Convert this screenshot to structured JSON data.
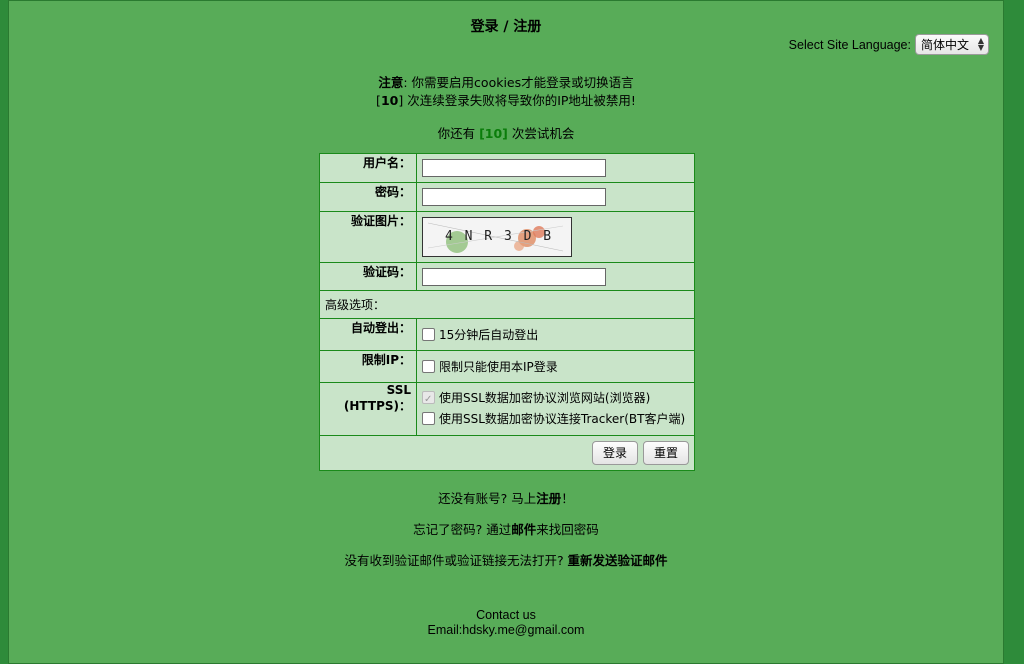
{
  "header": {
    "title": "登录 / 注册"
  },
  "language": {
    "label": "Select Site Language:",
    "selected": "简体中文"
  },
  "notice": {
    "bold_prefix": "注意",
    "line1_rest": ": 你需要启用cookies才能登录或切换语言",
    "count": "10",
    "line2_rest": " 次连续登录失败将导致你的IP地址被禁用!"
  },
  "remaining": {
    "prefix": "你还有 ",
    "count": "[10]",
    "suffix": " 次尝试机会"
  },
  "form": {
    "username_label": "用户名：",
    "password_label": "密码：",
    "captcha_label": "验证图片：",
    "captcha_text": "4 N R 3 D B",
    "code_label": "验证码：",
    "advanced_label": "高级选项：",
    "autologout_label": "自动登出：",
    "autologout_option": "15分钟后自动登出",
    "restrict_ip_label": "限制IP：",
    "restrict_ip_option": "限制只能使用本IP登录",
    "ssl_label": "SSL (HTTPS)：",
    "ssl_browse_option": "使用SSL数据加密协议浏览网站(浏览器)",
    "ssl_tracker_option": "使用SSL数据加密协议连接Tracker(BT客户端)",
    "login_button": "登录",
    "reset_button": "重置"
  },
  "links": {
    "no_account_prefix": "还没有账号? 马上",
    "register_link": "注册",
    "no_account_suffix": "！",
    "forgot_prefix": "忘记了密码? 通过",
    "email_link": "邮件",
    "forgot_suffix": "来找回密码",
    "resend_prefix": "没有收到验证邮件或验证链接无法打开? ",
    "resend_link": "重新发送验证邮件"
  },
  "footer": {
    "contact": "Contact us",
    "email": "Email:hdsky.me@gmail.com"
  },
  "colors": {
    "page_bg": "#58ac58",
    "outer_bg": "#2e8b3a",
    "form_bg": "#c9e4c9",
    "highlight_green": "#0a7d0a"
  }
}
